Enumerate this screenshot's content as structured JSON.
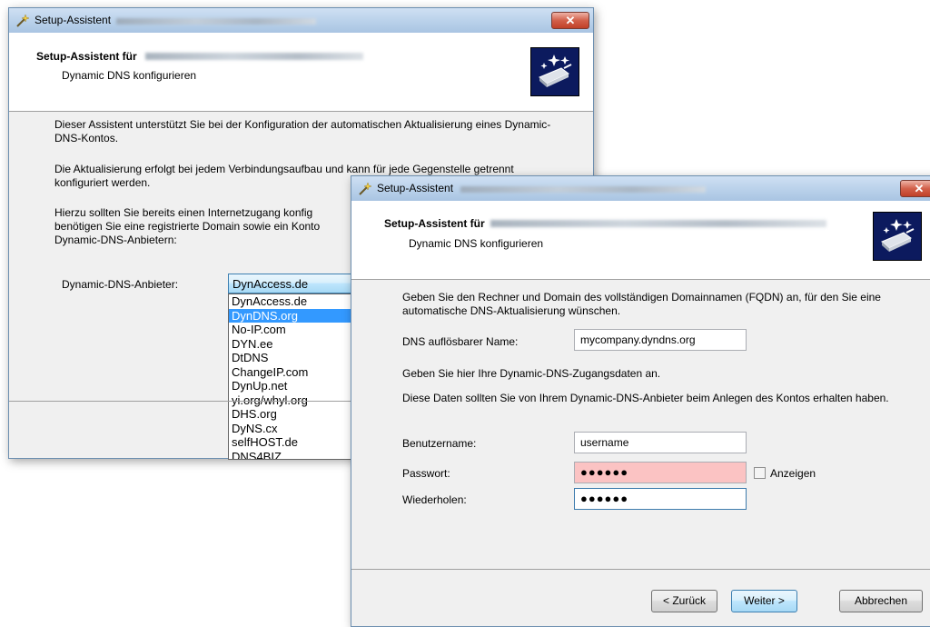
{
  "back_window": {
    "title": "Setup-Assistent",
    "close_label": "✕",
    "header_title": "Setup-Assistent für",
    "header_subtitle": "Dynamic DNS konfigurieren",
    "intro_1": "Dieser Assistent unterstützt Sie bei der Konfiguration der automatischen Aktualisierung eines Dynamic-DNS-Kontos.",
    "intro_2": "Die Aktualisierung erfolgt bei jedem Verbindungsaufbau und kann für jede Gegenstelle getrennt konfiguriert werden.",
    "intro_3_partial": "Hierzu sollten Sie bereits einen Internetzugang konfig benötigen Sie eine registrierte Domain sowie ein Konto Dynamic-DNS-Anbietern:",
    "provider_label": "Dynamic-DNS-Anbieter:",
    "provider_selected": "DynAccess.de",
    "provider_options": [
      "DynAccess.de",
      "DynDNS.org",
      "No-IP.com",
      "DYN.ee",
      "DtDNS",
      "ChangeIP.com",
      "DynUp.net",
      "yi.org/whyl.org",
      "DHS.org",
      "DyNS.cx",
      "selfHOST.de",
      "DNS4BIZ"
    ],
    "highlighted_option": "DynDNS.org"
  },
  "front_window": {
    "title": "Setup-Assistent",
    "close_label": "✕",
    "header_title": "Setup-Assistent für",
    "header_subtitle": "Dynamic DNS konfigurieren",
    "intro": "Geben Sie den Rechner und Domain des vollständigen Domainnamen (FQDN) an, für den Sie eine automatische DNS-Aktualisierung wünschen.",
    "dns_name_label": "DNS auflösbarer Name:",
    "dns_name_value": "mycompany.dyndns.org",
    "credentials_intro": "Geben Sie hier Ihre Dynamic-DNS-Zugangsdaten an.",
    "credentials_note": "Diese Daten sollten Sie von Ihrem Dynamic-DNS-Anbieter beim Anlegen des Kontos erhalten haben.",
    "username_label": "Benutzername:",
    "username_value": "username",
    "password_label": "Passwort:",
    "password_value": "●●●●●●",
    "show_label": "Anzeigen",
    "repeat_label": "Wiederholen:",
    "repeat_value": "●●●●●●",
    "back_button": "< Zurück",
    "next_button": "Weiter >",
    "cancel_button": "Abbrechen"
  },
  "colors": {
    "titlebar": "#b9d1ea",
    "close_button": "#c04028",
    "selection": "#3399ff",
    "password_error_bg": "#fbc3c3",
    "wizard_icon_bg": "#0c1a5e"
  },
  "icons": {
    "title_icon": "magic-wand-icon",
    "wizard_icon": "wizard-router-icon"
  }
}
